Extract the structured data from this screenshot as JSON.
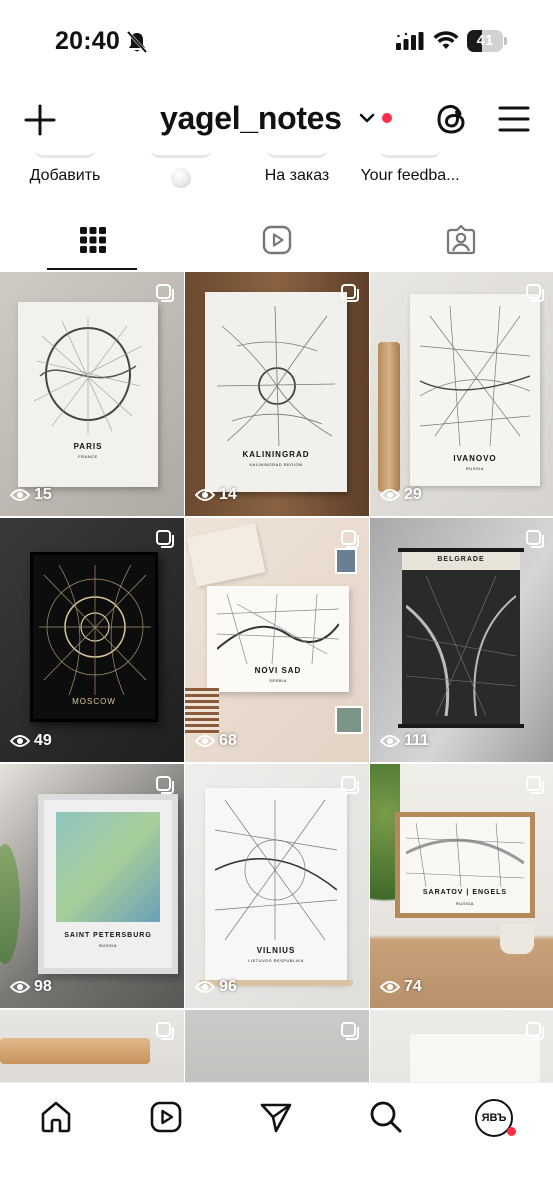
{
  "status_bar": {
    "time": "20:40",
    "battery": "41",
    "battery_level": 0.41,
    "icons": [
      "bell-slash-icon",
      "signal-icon",
      "wifi-icon",
      "battery-icon"
    ]
  },
  "header": {
    "username": "yagel_notes",
    "icons": [
      "plus-icon",
      "chevron-down-icon",
      "threads-icon",
      "menu-icon"
    ],
    "accent_color": "#ff2d45"
  },
  "highlights": [
    {
      "label": "Добавить"
    },
    {
      "label": ""
    },
    {
      "label": "На заказ"
    },
    {
      "label": "Your feedba..."
    }
  ],
  "tabs": [
    {
      "name": "grid",
      "icon": "grid-icon",
      "active": true
    },
    {
      "name": "reels",
      "icon": "reels-icon",
      "active": false
    },
    {
      "name": "tagged",
      "icon": "tagged-icon",
      "active": false
    }
  ],
  "posts": [
    {
      "views": "15",
      "city": "PARIS",
      "sub": "FRANCE"
    },
    {
      "views": "14",
      "city": "KALININGRAD",
      "sub": "KALININGRAD REGION"
    },
    {
      "views": "29",
      "city": "IVANOVO",
      "sub": "RUSSIA"
    },
    {
      "views": "49",
      "city": "MOSCOW",
      "sub": ""
    },
    {
      "views": "68",
      "city": "NOVI SAD",
      "sub": "SERBIA"
    },
    {
      "views": "111",
      "city": "BELGRADE",
      "sub": ""
    },
    {
      "views": "98",
      "city": "SAINT PETERSBURG",
      "sub": "RUSSIA"
    },
    {
      "views": "96",
      "city": "VILNIUS",
      "sub": "LIETUVOS RESPUBLIKA"
    },
    {
      "views": "74",
      "city": "SARATOV | ENGELS",
      "sub": "RUSSIA"
    }
  ],
  "bottom_nav": {
    "items": [
      "home-icon",
      "reels-icon",
      "send-icon",
      "search-icon"
    ],
    "avatar_text": "ЯВЪ"
  }
}
